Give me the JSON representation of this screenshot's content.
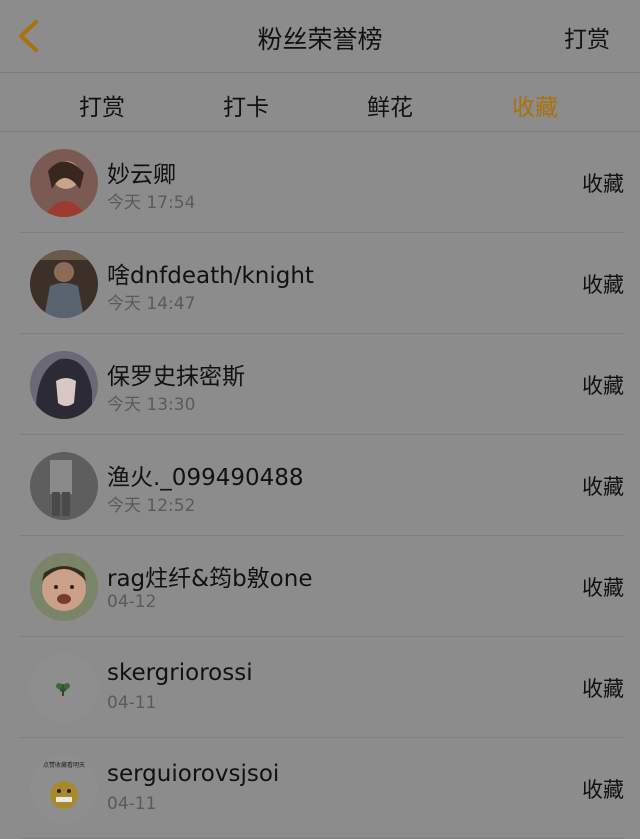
{
  "header": {
    "title": "粉丝荣誉榜",
    "reward_link": "打赏",
    "accent_color": "#a9720c"
  },
  "tabs": [
    {
      "label": "打赏",
      "active": false
    },
    {
      "label": "打卡",
      "active": false
    },
    {
      "label": "鲜花",
      "active": false
    },
    {
      "label": "收藏",
      "active": true
    }
  ],
  "rows": [
    {
      "name": "妙云卿",
      "time": "今天 17:54",
      "action": "收藏"
    },
    {
      "name": "啥dnfdeath/knight",
      "time": "今天 14:47",
      "action": "收藏"
    },
    {
      "name": "保罗史抹密斯",
      "time": "今天 13:30",
      "action": "收藏"
    },
    {
      "name": "渔火._099490488",
      "time": "今天 12:52",
      "action": "收藏"
    },
    {
      "name": "rag炷纤&筠b敫one",
      "time": "04-12",
      "action": "收藏"
    },
    {
      "name": "skergriorossi",
      "time": "04-11",
      "action": "收藏"
    },
    {
      "name": "serguiorovsjsoi",
      "time": "04-11",
      "action": "收藏",
      "avatar_caption": "点赞收藏看明天"
    }
  ]
}
